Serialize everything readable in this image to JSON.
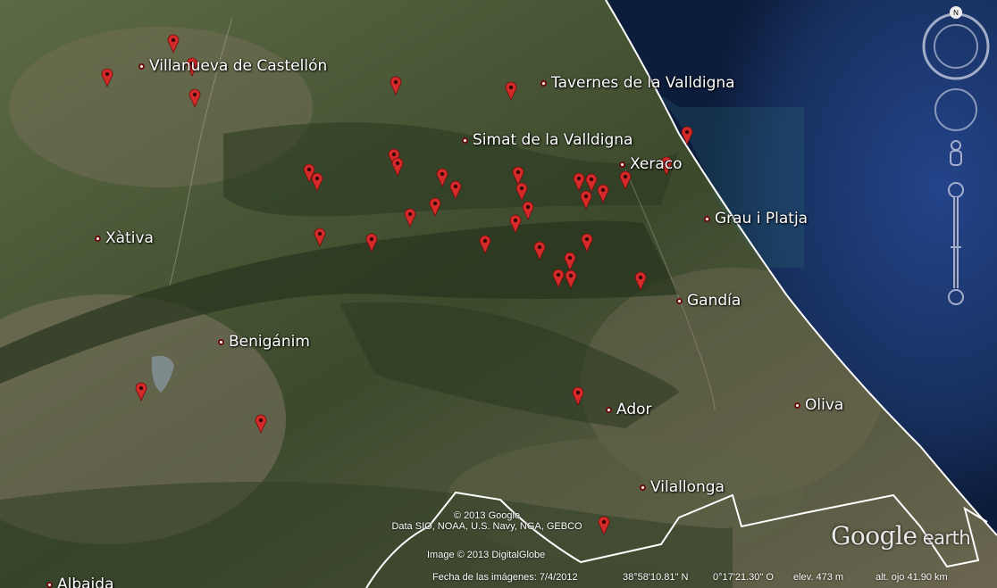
{
  "places": [
    {
      "id": "villanueva",
      "name": "Villanueva de Castellón"
    },
    {
      "id": "tavernes",
      "name": "Tavernes de la Valldigna"
    },
    {
      "id": "simat",
      "name": "Simat de la Valldigna"
    },
    {
      "id": "xeraco",
      "name": "Xeraco"
    },
    {
      "id": "grau",
      "name": "Grau i Platja"
    },
    {
      "id": "xativa",
      "name": "Xàtiva"
    },
    {
      "id": "gandia",
      "name": "Gandía"
    },
    {
      "id": "beniganim",
      "name": "Benigánim"
    },
    {
      "id": "ador",
      "name": "Ador"
    },
    {
      "id": "oliva",
      "name": "Oliva"
    },
    {
      "id": "vilallonga",
      "name": "Vilallonga"
    },
    {
      "id": "albaida",
      "name": "Albaida"
    }
  ],
  "placemark_count": 44,
  "credits": {
    "copyright": "© 2013 Google",
    "data": "Data SIO, NOAA, U.S. Navy, NGA, GEBCO",
    "image": "Image © 2013 DigitalGlobe"
  },
  "status": {
    "imagery_date": "Fecha de las imágenes: 7/4/2012",
    "lat": "38°58'10.81\" N",
    "lon": "0°17'21.30\" O",
    "elev": "elev.   473 m",
    "eye_alt": "alt. ojo   41.90 km"
  },
  "nav": {
    "north_label": "N"
  },
  "logo": {
    "text1": "Google",
    "text2": " earth"
  },
  "colors": {
    "pin": "#d42a2a",
    "sea": "#16305e",
    "land": "#3d4d2f",
    "border": "#ffffff"
  }
}
